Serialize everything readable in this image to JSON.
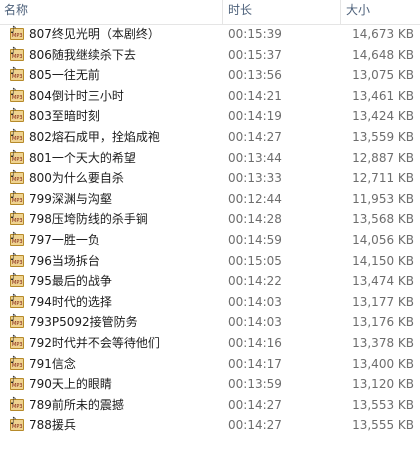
{
  "columns": {
    "name": "名称",
    "duration": "时长",
    "size": "大小"
  },
  "icon": {
    "semantic": "mp3-file-icon",
    "label": "MP3",
    "color": "#efd390"
  },
  "files": [
    {
      "name": "807终见光明（本剧终）",
      "duration": "00:15:39",
      "size": "14,673 KB"
    },
    {
      "name": "806随我继续杀下去",
      "duration": "00:15:37",
      "size": "14,648 KB"
    },
    {
      "name": "805一往无前",
      "duration": "00:13:56",
      "size": "13,075 KB"
    },
    {
      "name": "804倒计时三小时",
      "duration": "00:14:21",
      "size": "13,461 KB"
    },
    {
      "name": "803至暗时刻",
      "duration": "00:14:19",
      "size": "13,424 KB"
    },
    {
      "name": "802熔石成甲，拴焰成袍",
      "duration": "00:14:27",
      "size": "13,559 KB"
    },
    {
      "name": "801一个天大的希望",
      "duration": "00:13:44",
      "size": "12,887 KB"
    },
    {
      "name": "800为什么要自杀",
      "duration": "00:13:33",
      "size": "12,711 KB"
    },
    {
      "name": "799深渊与沟壑",
      "duration": "00:12:44",
      "size": "11,953 KB"
    },
    {
      "name": "798压垮防线的杀手锏",
      "duration": "00:14:28",
      "size": "13,568 KB"
    },
    {
      "name": "797一胜一负",
      "duration": "00:14:59",
      "size": "14,056 KB"
    },
    {
      "name": "796当场拆台",
      "duration": "00:15:05",
      "size": "14,150 KB"
    },
    {
      "name": "795最后的战争",
      "duration": "00:14:22",
      "size": "13,474 KB"
    },
    {
      "name": "794时代的选择",
      "duration": "00:14:03",
      "size": "13,177 KB"
    },
    {
      "name": "793P5092接管防务",
      "duration": "00:14:03",
      "size": "13,176 KB"
    },
    {
      "name": "792时代并不会等待他们",
      "duration": "00:14:16",
      "size": "13,378 KB"
    },
    {
      "name": "791信念",
      "duration": "00:14:17",
      "size": "13,400 KB"
    },
    {
      "name": "790天上的眼睛",
      "duration": "00:13:59",
      "size": "13,120 KB"
    },
    {
      "name": "789前所未的震撼",
      "duration": "00:14:27",
      "size": "13,553 KB"
    },
    {
      "name": "788援兵",
      "duration": "00:14:27",
      "size": "13,555 KB"
    }
  ]
}
